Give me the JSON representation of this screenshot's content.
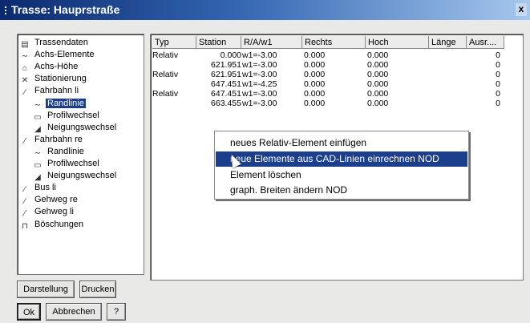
{
  "window": {
    "title": "Trasse: Hauprstraße",
    "close_label": "x"
  },
  "tree": [
    {
      "label": "Trassendaten",
      "icon": "document-icon",
      "glyph": "▤",
      "indent": 0
    },
    {
      "label": "Achs-Elemente",
      "icon": "curve-icon",
      "glyph": "∼",
      "indent": 0
    },
    {
      "label": "Achs-Höhe",
      "icon": "height-icon",
      "glyph": "⌂",
      "indent": 0
    },
    {
      "label": "Stationierung",
      "icon": "station-icon",
      "glyph": "✕",
      "indent": 0
    },
    {
      "label": "Fahrbahn li",
      "icon": "lane-icon",
      "glyph": "⁄",
      "indent": 0
    },
    {
      "label": "Randlinie",
      "icon": "curve-icon",
      "glyph": "∼",
      "indent": 1,
      "selected": true
    },
    {
      "label": "Profilwechsel",
      "icon": "profile-icon",
      "glyph": "▭",
      "indent": 1
    },
    {
      "label": "Neigungswechsel",
      "icon": "slope-icon",
      "glyph": "◢",
      "indent": 1
    },
    {
      "label": "Fahrbahn re",
      "icon": "lane-icon",
      "glyph": "⁄",
      "indent": 0
    },
    {
      "label": "Randlinie",
      "icon": "curve-icon",
      "glyph": "∼",
      "indent": 1
    },
    {
      "label": "Profilwechsel",
      "icon": "profile-icon",
      "glyph": "▭",
      "indent": 1
    },
    {
      "label": "Neigungswechsel",
      "icon": "slope-icon",
      "glyph": "◢",
      "indent": 1
    },
    {
      "label": "Bus li",
      "icon": "lane-icon",
      "glyph": "⁄",
      "indent": 0
    },
    {
      "label": "Gehweg re",
      "icon": "lane-icon",
      "glyph": "⁄",
      "indent": 0
    },
    {
      "label": "Gehweg li",
      "icon": "lane-icon",
      "glyph": "⁄",
      "indent": 0
    },
    {
      "label": "Böschungen",
      "icon": "embankment-icon",
      "glyph": "⊓",
      "indent": 0
    }
  ],
  "table": {
    "columns": [
      "Typ",
      "Station",
      "R/A/w1",
      "Rechts",
      "Hoch",
      "Länge",
      "Ausr...."
    ],
    "rows": [
      {
        "typ": "Relativ",
        "station": "0.000",
        "raw": "w1=-3.00",
        "rechts": "0.000",
        "hoch": "0.000",
        "laenge": "",
        "ausr": "0"
      },
      {
        "typ": "",
        "station": "621.951",
        "raw": "w1=-3.00",
        "rechts": "0.000",
        "hoch": "0.000",
        "laenge": "",
        "ausr": "0"
      },
      {
        "typ": "Relativ",
        "station": "621.951",
        "raw": "w1=-3.00",
        "rechts": "0.000",
        "hoch": "0.000",
        "laenge": "",
        "ausr": "0"
      },
      {
        "typ": "",
        "station": "647.451",
        "raw": "w1=-4.25",
        "rechts": "0.000",
        "hoch": "0.000",
        "laenge": "",
        "ausr": "0"
      },
      {
        "typ": "Relativ",
        "station": "647.451",
        "raw": "w1=-3.00",
        "rechts": "0.000",
        "hoch": "0.000",
        "laenge": "",
        "ausr": "0"
      },
      {
        "typ": "",
        "station": "663.455",
        "raw": "w1=-3.00",
        "rechts": "0.000",
        "hoch": "0.000",
        "laenge": "",
        "ausr": "0"
      }
    ]
  },
  "context_menu": {
    "items": [
      {
        "label": "neues Relativ-Element einfügen"
      },
      {
        "label": "neue Elemente aus CAD-Linien einrechnen NOD",
        "highlighted": true
      },
      {
        "label": "Element löschen"
      },
      {
        "label": "graph. Breiten ändern NOD"
      }
    ]
  },
  "buttons": {
    "darstellung": "Darstellung",
    "drucken": "Drucken",
    "ok": "Ok",
    "abbrechen": "Abbrechen",
    "help": "?"
  },
  "colors": {
    "selection": "#1b3f8c",
    "title_start": "#0b2a6e",
    "title_end": "#a6c8ee"
  }
}
